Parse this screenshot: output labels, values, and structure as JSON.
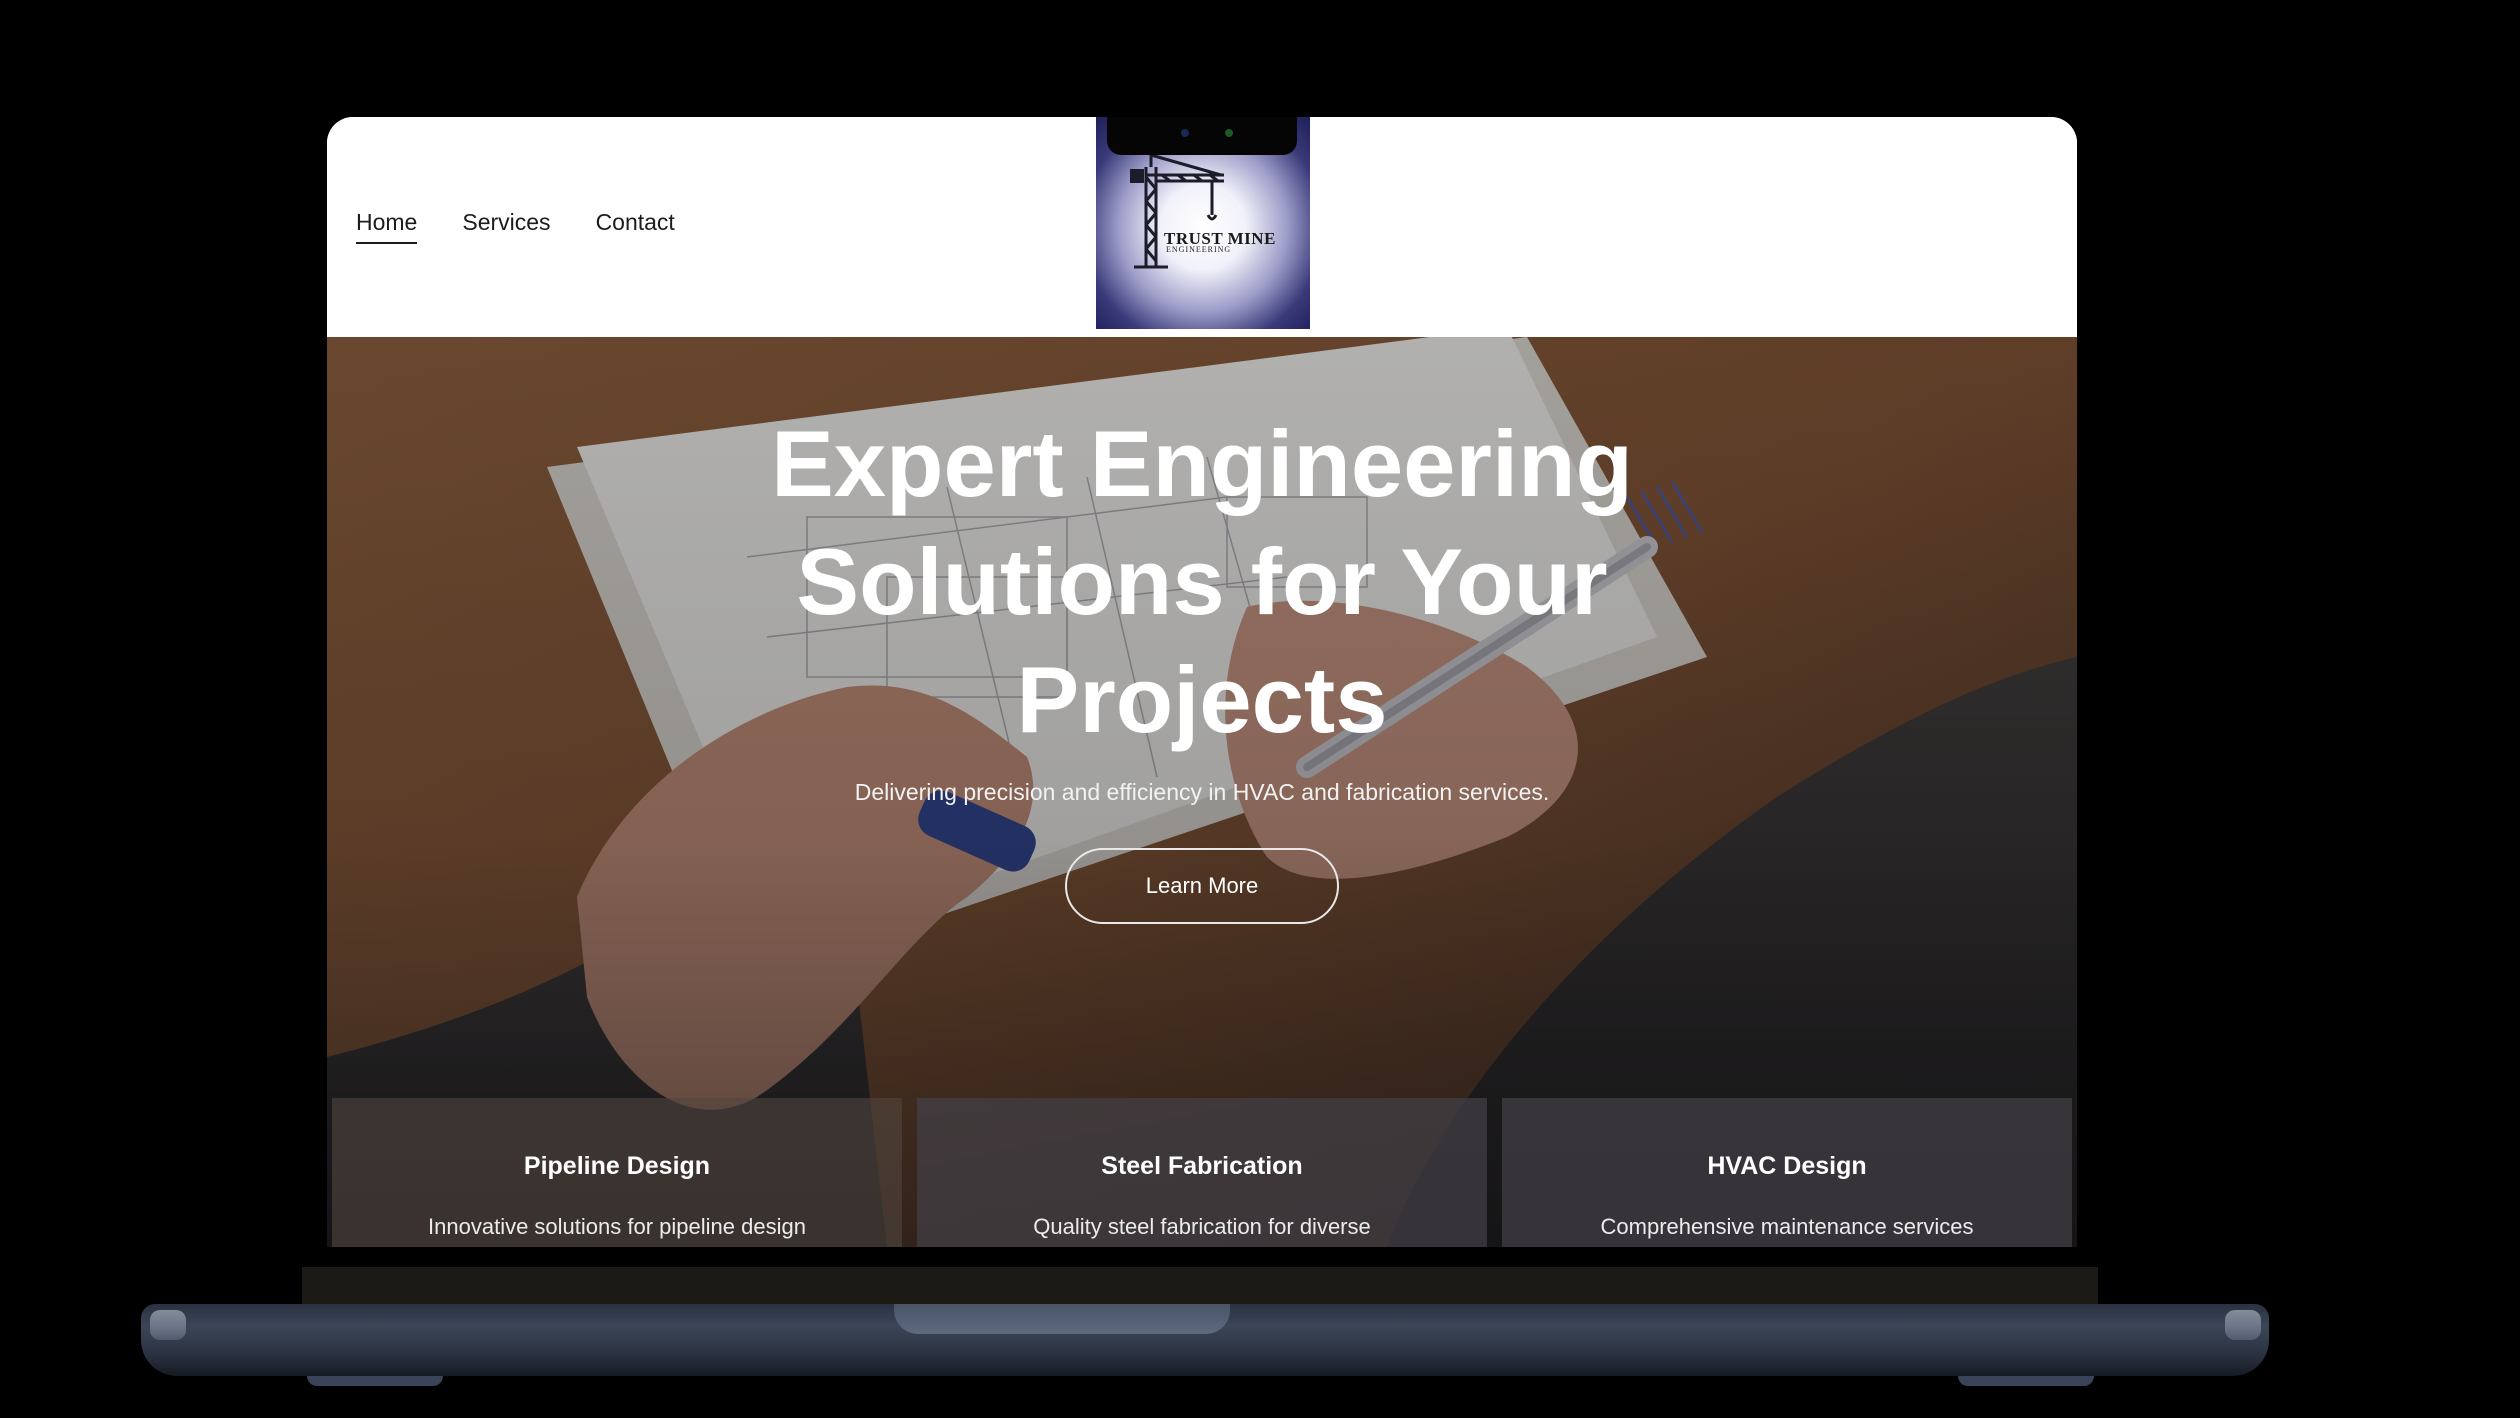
{
  "nav": {
    "items": [
      {
        "label": "Home",
        "active": true
      },
      {
        "label": "Services",
        "active": false
      },
      {
        "label": "Contact",
        "active": false
      }
    ]
  },
  "logo": {
    "text": "TRUST MINE",
    "subtext": "ENGINEERING",
    "icon": "crane-icon"
  },
  "hero": {
    "title_line1": "Expert Engineering",
    "title_line2": "Solutions for Your",
    "title_line3": "Projects",
    "subtitle": "Delivering precision and efficiency in HVAC and fabrication services.",
    "cta_label": "Learn More"
  },
  "services": [
    {
      "title": "Pipeline Design",
      "description": "Innovative solutions for pipeline design and erection."
    },
    {
      "title": "Steel Fabrication",
      "description": "Quality steel fabrication for diverse applications."
    },
    {
      "title": "HVAC Design",
      "description": "Comprehensive maintenance services for optimal performance."
    }
  ],
  "colors": {
    "header_bg": "#ffffff",
    "nav_text": "#1c1c1c",
    "hero_text": "#ffffff",
    "card_bg": "#424046",
    "logo_bg": "#1e1e5a"
  }
}
